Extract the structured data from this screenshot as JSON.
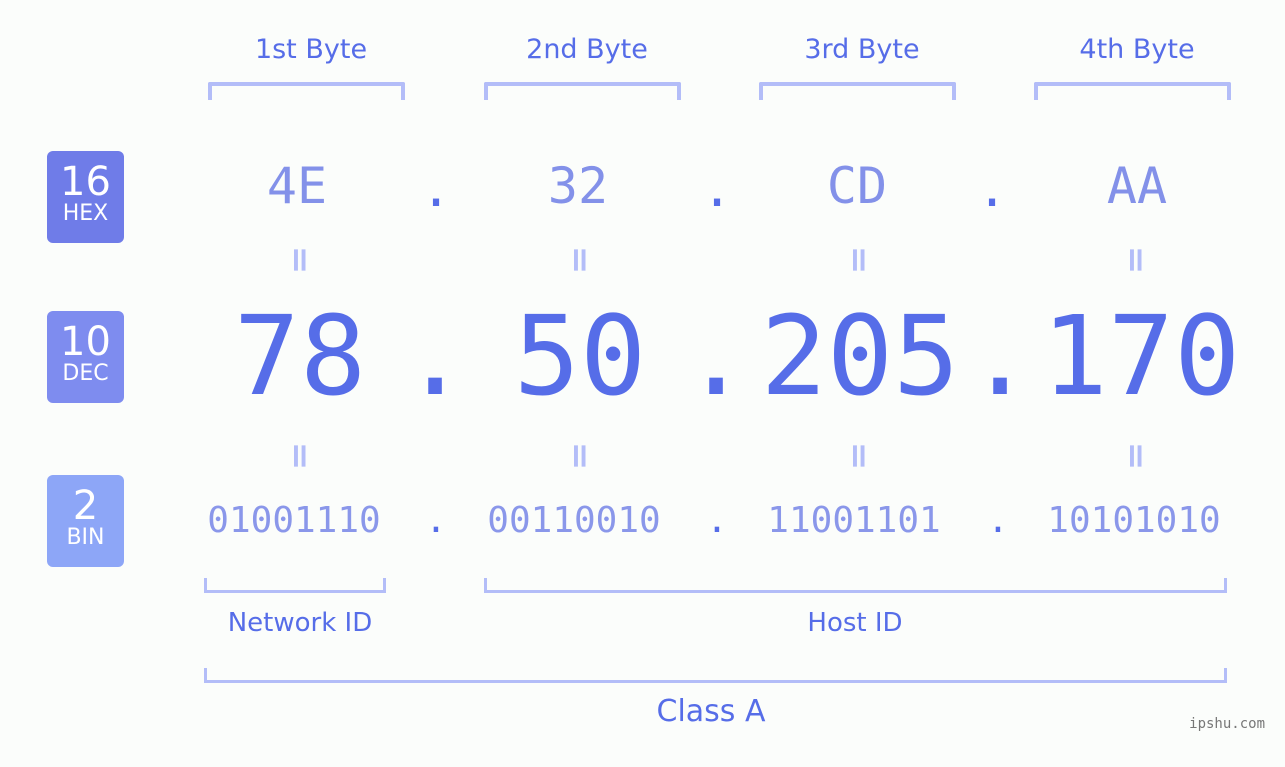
{
  "ip": {
    "dotted_decimal": "78.50.205.170",
    "byte_labels": [
      "1st Byte",
      "2nd Byte",
      "3rd Byte",
      "4th Byte"
    ],
    "hex": [
      "4E",
      "32",
      "CD",
      "AA"
    ],
    "dec": [
      "78",
      "50",
      "205",
      "170"
    ],
    "bin": [
      "01001110",
      "00110010",
      "11001101",
      "10101010"
    ],
    "separator": ".",
    "equals": "="
  },
  "badges": {
    "hex": {
      "number": "16",
      "label": "HEX",
      "color": "#6f7ce8"
    },
    "dec": {
      "number": "10",
      "label": "DEC",
      "color": "#7e8cef"
    },
    "bin": {
      "number": "2",
      "label": "BIN",
      "color": "#8da6f7"
    }
  },
  "segments": {
    "network_id": "Network ID",
    "host_id": "Host ID",
    "class": "Class A"
  },
  "colors": {
    "primary": "#566de8",
    "hex_text": "#8391e9",
    "bin_text": "#8a97ea",
    "bracket": "#b3bdf8",
    "background": "#fbfdfb"
  },
  "watermark": "ipshu.com"
}
